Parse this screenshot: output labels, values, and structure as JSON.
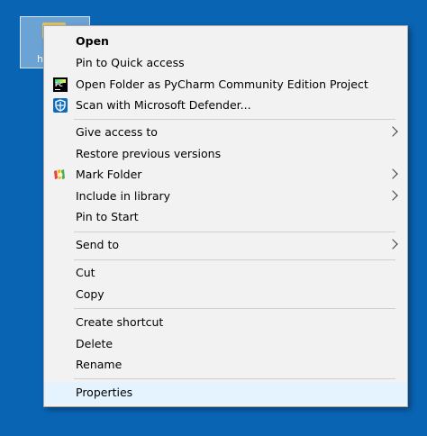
{
  "desktop": {
    "icon_label": "h"
  },
  "menu": {
    "items": [
      {
        "label": "Open"
      },
      {
        "label": "Pin to Quick access"
      },
      {
        "label": "Open Folder as PyCharm Community Edition Project",
        "icon": "pycharm-icon"
      },
      {
        "label": "Scan with Microsoft Defender...",
        "icon": "defender-shield-icon"
      },
      {
        "label": "Give access to",
        "submenu": true
      },
      {
        "label": "Restore previous versions"
      },
      {
        "label": "Mark Folder",
        "icon": "mark-folder-icon",
        "submenu": true
      },
      {
        "label": "Include in library",
        "submenu": true
      },
      {
        "label": "Pin to Start"
      },
      {
        "label": "Send to",
        "submenu": true
      },
      {
        "label": "Cut"
      },
      {
        "label": "Copy"
      },
      {
        "label": "Create shortcut"
      },
      {
        "label": "Delete"
      },
      {
        "label": "Rename"
      },
      {
        "label": "Properties",
        "highlighted": true
      }
    ],
    "pycharm_badge": "PC"
  },
  "colors": {
    "desktop_bg": "#0a64b4",
    "menu_bg": "#f2f2f2",
    "hover_bg": "#e5f3ff"
  }
}
